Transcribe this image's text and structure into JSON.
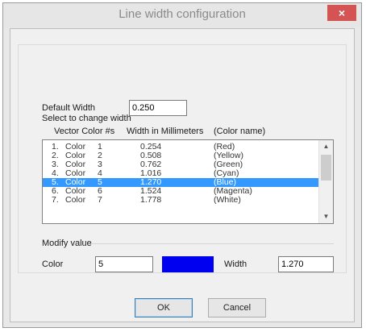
{
  "window": {
    "title": "Line width configuration",
    "close_glyph": "×"
  },
  "default_width": {
    "label": "Default Width",
    "value": "0.250"
  },
  "select_label": "Select to change width",
  "columns": [
    "Vector Color #s",
    "Width in Millimeters",
    "(Color name)"
  ],
  "rows": [
    {
      "num": "1.",
      "color": "Color",
      "idx": "1",
      "width": "0.254",
      "name": "(Red)",
      "selected": false
    },
    {
      "num": "2.",
      "color": "Color",
      "idx": "2",
      "width": "0.508",
      "name": "(Yellow)",
      "selected": false
    },
    {
      "num": "3.",
      "color": "Color",
      "idx": "3",
      "width": "0.762",
      "name": "(Green)",
      "selected": false
    },
    {
      "num": "4.",
      "color": "Color",
      "idx": "4",
      "width": "1.016",
      "name": "(Cyan)",
      "selected": false
    },
    {
      "num": "5.",
      "color": "Color",
      "idx": "5",
      "width": "1.270",
      "name": "(Blue)",
      "selected": true
    },
    {
      "num": "6.",
      "color": "Color",
      "idx": "6",
      "width": "1.524",
      "name": "(Magenta)",
      "selected": false
    },
    {
      "num": "7.",
      "color": "Color",
      "idx": "7",
      "width": "1.778",
      "name": "(White)",
      "selected": false
    }
  ],
  "modify": {
    "group_label": "Modify value",
    "color_label": "Color",
    "color_value": "5",
    "swatch_color": "#0000f0",
    "width_label": "Width",
    "width_value": "1.270"
  },
  "buttons": {
    "ok": "OK",
    "cancel": "Cancel"
  },
  "accents": {
    "selection": "#3399ff",
    "close": "#d45454"
  }
}
